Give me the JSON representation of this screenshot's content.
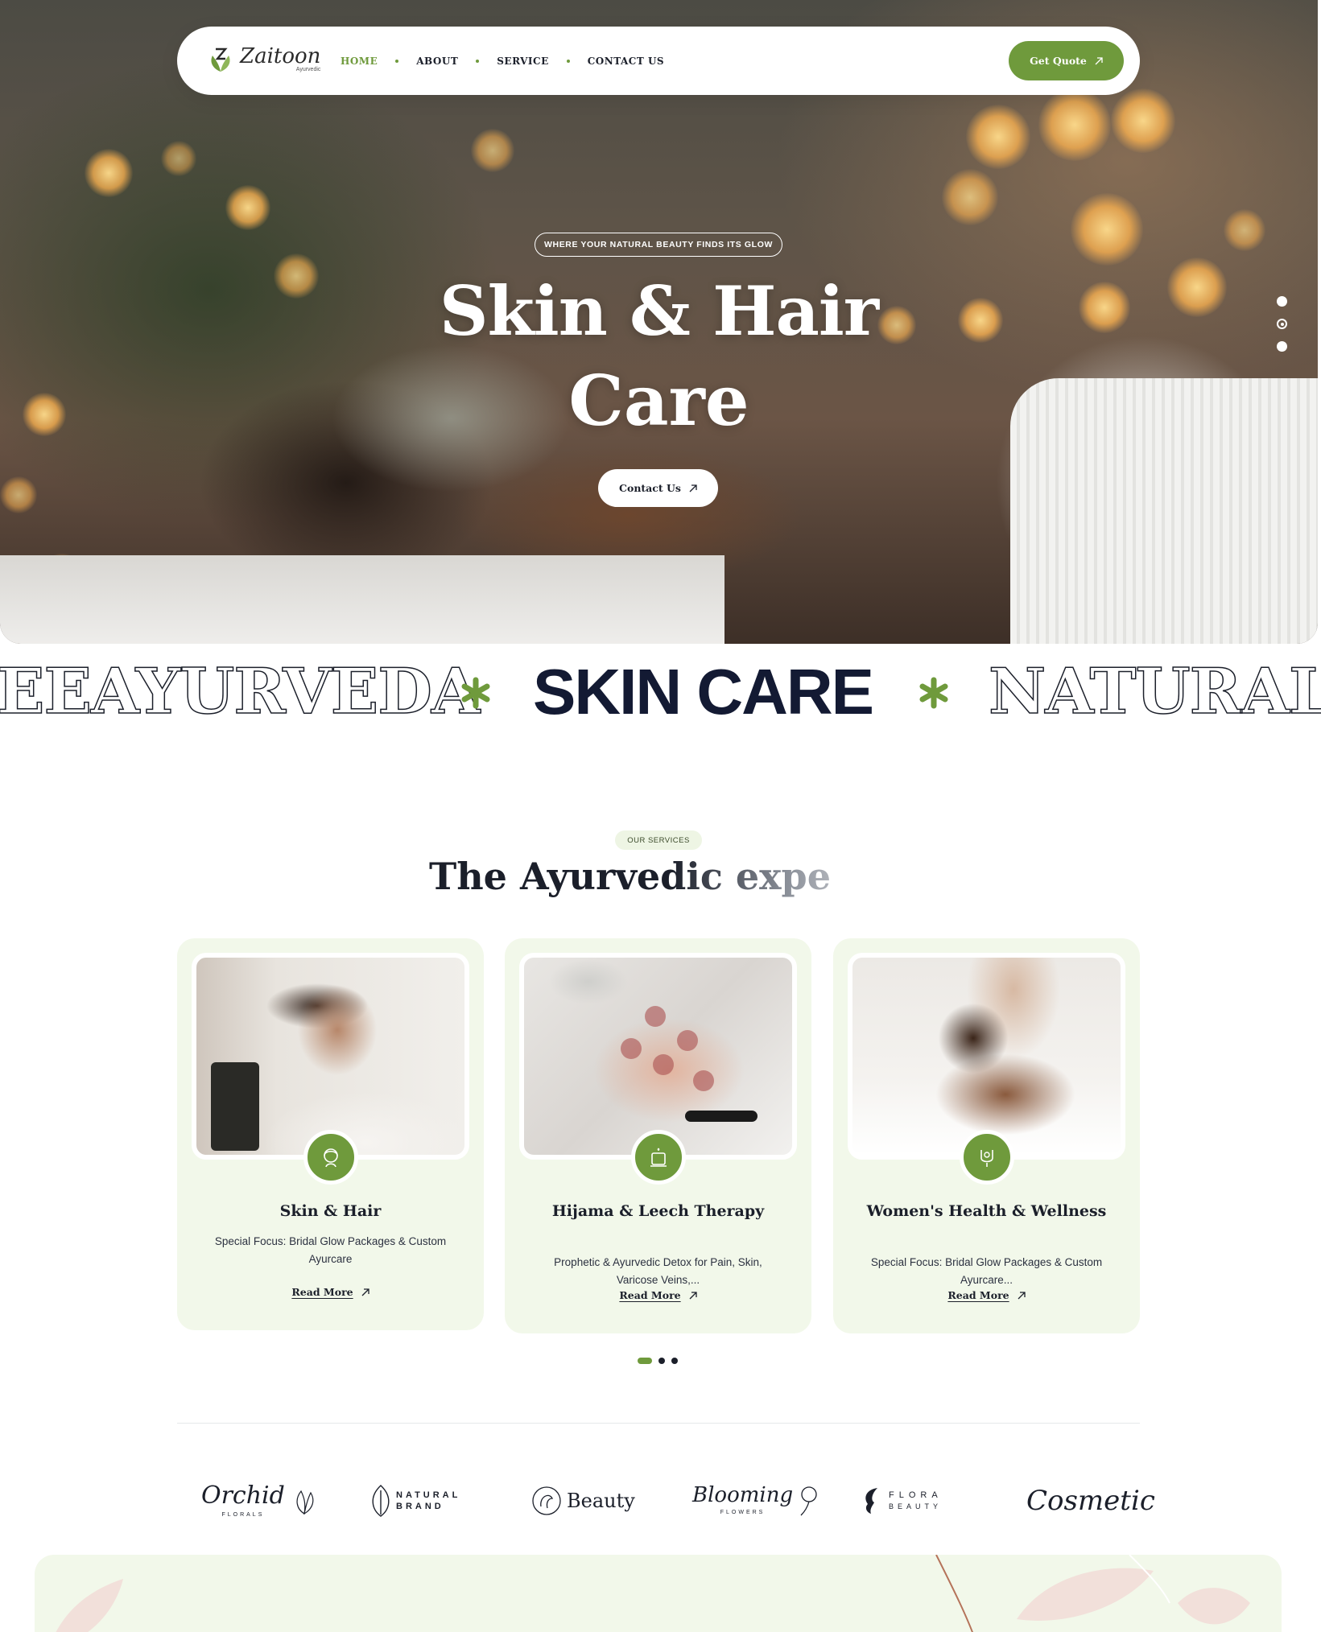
{
  "nav": {
    "logo_name": "Zaitoon",
    "logo_sub": "Ayurvedic",
    "items": [
      {
        "label": "HOME",
        "active": true
      },
      {
        "label": "ABOUT",
        "active": false
      },
      {
        "label": "SERVICE",
        "active": false
      },
      {
        "label": "CONTACT US",
        "active": false
      }
    ],
    "cta_label": "Get Quote"
  },
  "hero": {
    "tagline": "WHERE YOUR NATURAL BEAUTY FINDS ITS GLOW",
    "title_line1": "Skin & Hair",
    "title_line2": "Care",
    "button_label": "Contact Us",
    "slides": 3,
    "active_slide": 2
  },
  "marquee": {
    "items": [
      "EEAYURVEDA",
      "SKIN CARE",
      "NATURAL"
    ]
  },
  "services": {
    "badge": "OUR SERVICES",
    "title": "The Ayurvedic expe",
    "cards": [
      {
        "title": "Skin & Hair",
        "description": "Special Focus: Bridal Glow Packages & Custom Ayurcare",
        "link": "Read More",
        "icon": "face-care-icon"
      },
      {
        "title": "Hijama & Leech Therapy",
        "description": "Prophetic & Ayurvedic Detox for Pain, Skin, Varicose Veins,...",
        "link": "Read More",
        "icon": "oil-lamp-icon"
      },
      {
        "title": "Women's Health & Wellness",
        "description": "Special Focus: Bridal Glow Packages & Custom Ayurcare...",
        "link": "Read More",
        "icon": "massage-hands-icon"
      }
    ],
    "pages": 3,
    "active_page": 1
  },
  "brands": [
    {
      "name": "Orchid",
      "sub": "FLORALS"
    },
    {
      "name": "NATURAL",
      "sub": "BRAND"
    },
    {
      "name": "Beauty",
      "sub": ""
    },
    {
      "name": "Blooming",
      "sub": "FLOWERS"
    },
    {
      "name": "FLORA",
      "sub": "BEAUTY"
    },
    {
      "name": "Cosmetic",
      "sub": ""
    }
  ],
  "colors": {
    "accent": "#6f9a3c",
    "card_bg": "#f2f8ea",
    "dark": "#1b1f2a"
  }
}
